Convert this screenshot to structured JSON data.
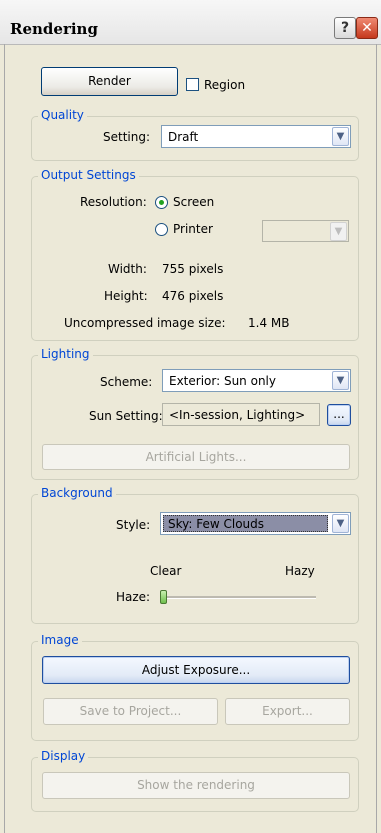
{
  "window": {
    "title": "Rendering",
    "help_label": "?",
    "close_label": "✕"
  },
  "top": {
    "render_label": "Render",
    "region_label": "Region",
    "region_checked": false
  },
  "quality": {
    "group_label": "Quality",
    "setting_label": "Setting:",
    "setting_value": "Draft"
  },
  "output": {
    "group_label": "Output Settings",
    "resolution_label": "Resolution:",
    "screen_label": "Screen",
    "printer_label": "Printer",
    "selected": "Screen",
    "width_label": "Width:",
    "width_value": "755 pixels",
    "height_label": "Height:",
    "height_value": "476 pixels",
    "size_label": "Uncompressed image size:",
    "size_value": "1.4 MB"
  },
  "lighting": {
    "group_label": "Lighting",
    "scheme_label": "Scheme:",
    "scheme_value": "Exterior: Sun only",
    "sun_label": "Sun Setting:",
    "sun_value": "<In-session, Lighting>",
    "browse_label": "...",
    "artificial_label": "Artificial Lights..."
  },
  "background": {
    "group_label": "Background",
    "style_label": "Style:",
    "style_value": "Sky: Few Clouds",
    "clear_label": "Clear",
    "hazy_label": "Hazy",
    "haze_label": "Haze:",
    "haze_level": 0
  },
  "image": {
    "group_label": "Image",
    "adjust_label": "Adjust Exposure...",
    "save_label": "Save to Project...",
    "export_label": "Export..."
  },
  "display": {
    "group_label": "Display",
    "show_label": "Show the rendering"
  },
  "icons": {
    "dropdown": "chevron-down-icon",
    "help": "question-icon",
    "close": "close-icon"
  }
}
